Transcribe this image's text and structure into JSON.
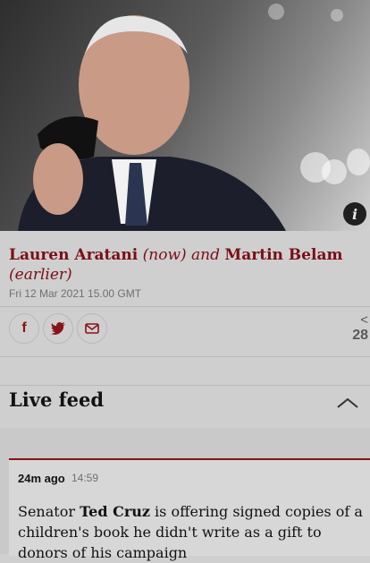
{
  "hero": {
    "info_label": "i"
  },
  "byline": {
    "author1": "Lauren Aratani",
    "author1_note": "(now)",
    "joiner": "and",
    "author2": "Martin Belam",
    "author2_note": "(earlier)"
  },
  "dateline": "Fri 12 Mar 2021 15.00 GMT",
  "share": {
    "buttons": [
      {
        "icon": "facebook-icon",
        "glyph": "f"
      },
      {
        "icon": "twitter-icon",
        "glyph": "twitter"
      },
      {
        "icon": "email-icon",
        "glyph": "envelope"
      }
    ],
    "count_glyph": "<",
    "count": "28"
  },
  "live_feed": {
    "title": "Live feed",
    "toggle_icon": "chevron-up-icon"
  },
  "post": {
    "ago": "24m ago",
    "time": "14:59",
    "text_before": "Senator ",
    "text_bold": "Ted Cruz",
    "text_after": " is offering signed copies of a children's book he didn't write as a gift to donors of his campaign"
  },
  "colors": {
    "accent": "#8a1219",
    "byline": "#7a0f15"
  }
}
